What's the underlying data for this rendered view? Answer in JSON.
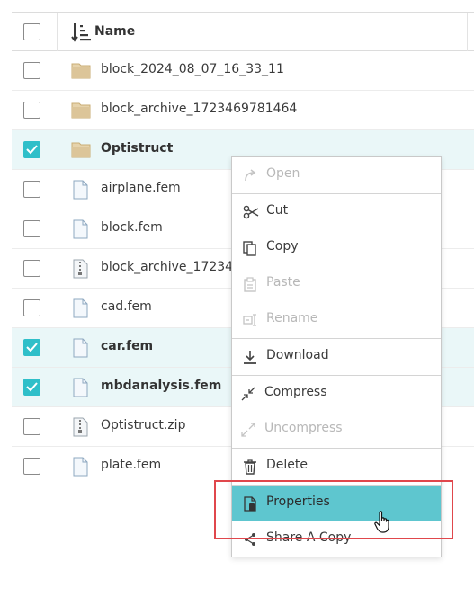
{
  "header": {
    "name_label": "Name"
  },
  "files": [
    {
      "name": "block_2024_08_07_16_33_11",
      "type": "folder",
      "checked": false
    },
    {
      "name": "block_archive_1723469781464",
      "type": "folder",
      "checked": false
    },
    {
      "name": "Optistruct",
      "type": "folder",
      "checked": true
    },
    {
      "name": "airplane.fem",
      "type": "file",
      "checked": false
    },
    {
      "name": "block.fem",
      "type": "file",
      "checked": false
    },
    {
      "name": "block_archive_17234",
      "type": "zip",
      "checked": false
    },
    {
      "name": "cad.fem",
      "type": "file",
      "checked": false
    },
    {
      "name": "car.fem",
      "type": "file",
      "checked": true
    },
    {
      "name": "mbdanalysis.fem",
      "type": "file",
      "checked": true
    },
    {
      "name": "Optistruct.zip",
      "type": "zip",
      "checked": false
    },
    {
      "name": "plate.fem",
      "type": "file",
      "checked": false
    }
  ],
  "context_menu": {
    "open": "Open",
    "cut": "Cut",
    "copy": "Copy",
    "paste": "Paste",
    "rename": "Rename",
    "download": "Download",
    "compress": "Compress",
    "uncompress": "Uncompress",
    "delete": "Delete",
    "properties": "Properties",
    "share_a_copy": "Share A Copy"
  },
  "colors": {
    "accent": "#2fbfc9",
    "highlight": "#5ec6cf",
    "annotation": "#e0474c"
  }
}
